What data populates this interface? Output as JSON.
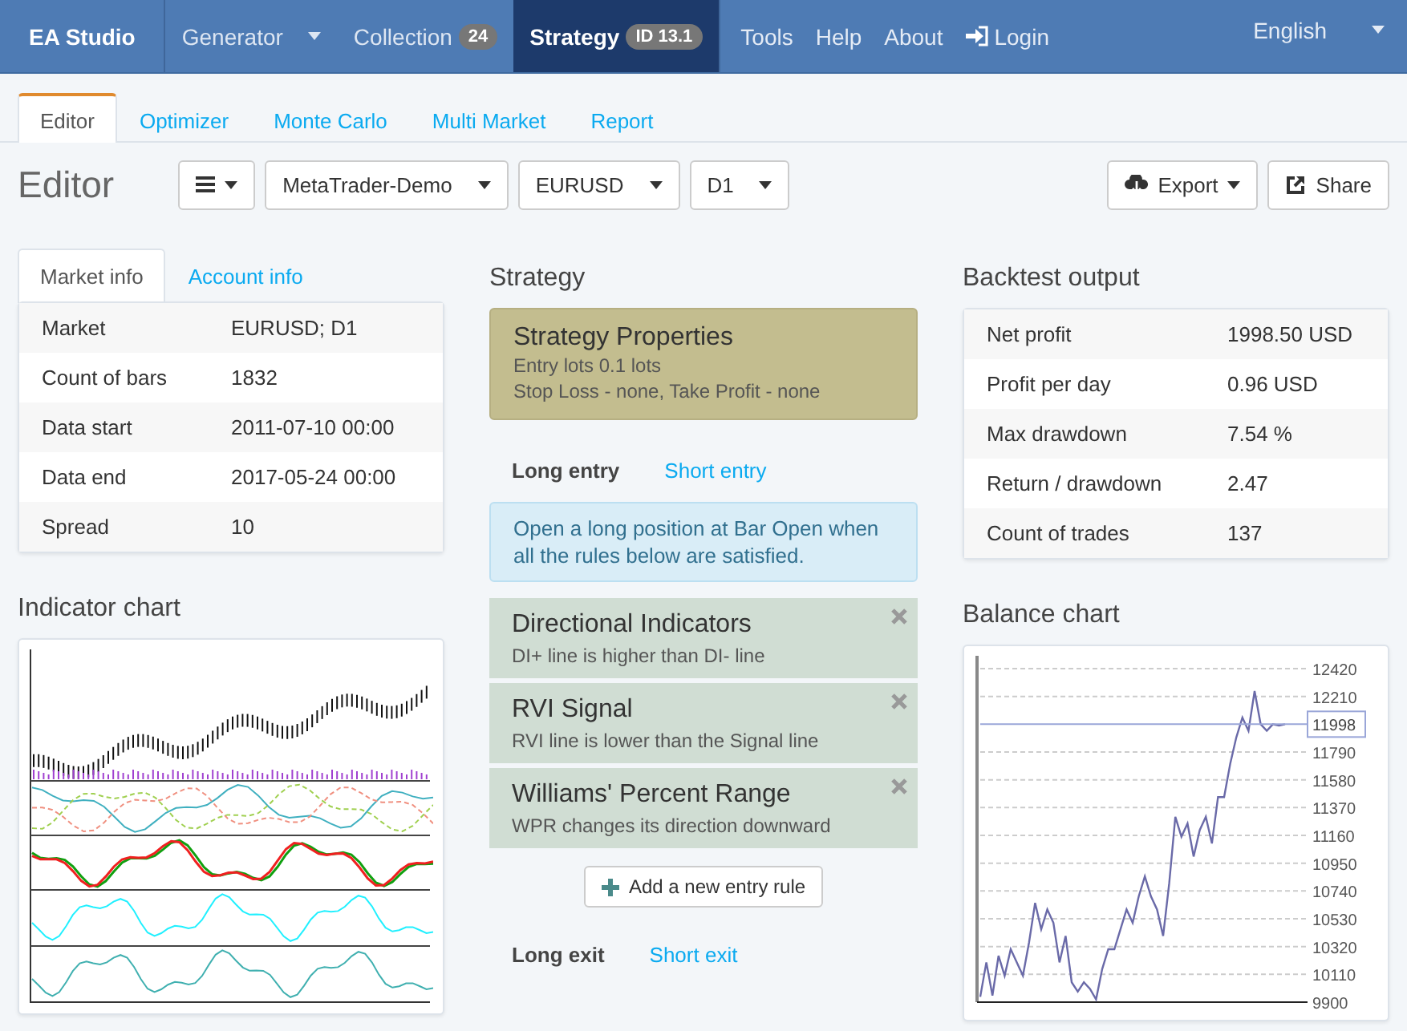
{
  "navbar": {
    "brand": "EA Studio",
    "items": [
      {
        "label": "Generator",
        "caret": true,
        "selected": false
      },
      {
        "label": "Collection",
        "badge": "24",
        "selected": false
      },
      {
        "label": "Strategy",
        "badge": "ID 13.1",
        "selected": true
      }
    ],
    "links": [
      {
        "label": "Tools"
      },
      {
        "label": "Help"
      },
      {
        "label": "About"
      },
      {
        "label": "Login"
      }
    ],
    "language": "English"
  },
  "tabs": [
    {
      "label": "Editor",
      "selected": true
    },
    {
      "label": "Optimizer",
      "selected": false
    },
    {
      "label": "Monte Carlo",
      "selected": false
    },
    {
      "label": "Multi Market",
      "selected": false
    },
    {
      "label": "Report",
      "selected": false
    }
  ],
  "toolbar": {
    "title": "Editor",
    "selects": [
      "MetaTrader-Demo",
      "EURUSD",
      "D1"
    ],
    "export": "Export",
    "share": "Share"
  },
  "info": {
    "tabs": [
      {
        "label": "Market info",
        "selected": true
      },
      {
        "label": "Account info",
        "selected": false
      }
    ],
    "rows": [
      [
        "Market",
        "EURUSD; D1"
      ],
      [
        "Count of bars",
        "1832"
      ],
      [
        "Data start",
        "2011-07-10 00:00"
      ],
      [
        "Data end",
        "2017-05-24 00:00"
      ],
      [
        "Spread",
        "10"
      ]
    ]
  },
  "indicator_chart": {
    "title": "Indicator chart"
  },
  "strategy": {
    "title": "Strategy",
    "properties": {
      "title": "Strategy Properties",
      "lines": [
        "Entry lots 0.1 lots",
        "Stop Loss - none, Take Profit - none"
      ]
    },
    "entry_tabs": [
      {
        "label": "Long entry",
        "selected": true
      },
      {
        "label": "Short entry",
        "selected": false
      }
    ],
    "note": "Open a long position at Bar Open when all the rules below are satisfied.",
    "rules": [
      {
        "title": "Directional Indicators",
        "text": "DI+ line is higher than DI- line"
      },
      {
        "title": "RVI Signal",
        "text": "RVI line is lower than the Signal line"
      },
      {
        "title": "Williams' Percent Range",
        "text": "WPR changes its direction downward"
      }
    ],
    "add_rule": "Add a new entry rule",
    "exit_tabs": [
      {
        "label": "Long exit",
        "selected": true
      },
      {
        "label": "Short exit",
        "selected": false
      }
    ]
  },
  "backtest": {
    "title": "Backtest output",
    "rows": [
      [
        "Net profit",
        "1998.50 USD"
      ],
      [
        "Profit per day",
        "0.96 USD"
      ],
      [
        "Max drawdown",
        "7.54 %"
      ],
      [
        "Return / drawdown",
        "2.47"
      ],
      [
        "Count of trades",
        "137"
      ]
    ]
  },
  "balance_chart": {
    "title": "Balance chart",
    "current": "11998",
    "chart_data": {
      "type": "line",
      "grid": true,
      "ylim": [
        9900,
        12420
      ],
      "yticks": [
        9900,
        10110,
        10320,
        10530,
        10740,
        10950,
        11160,
        11370,
        11580,
        11790,
        12210,
        12420
      ],
      "series": [
        {
          "color": "#6a6aa8",
          "values": [
            9940,
            10200,
            9950,
            10250,
            10100,
            10300,
            10200,
            10100,
            10350,
            10650,
            10450,
            10600,
            10500,
            10200,
            10400,
            10050,
            9980,
            10050,
            10000,
            9920,
            10150,
            10300,
            10300,
            10450,
            10600,
            10500,
            10700,
            10850,
            10700,
            10600,
            10400,
            10800,
            11300,
            11150,
            11250,
            11000,
            11200,
            11300,
            11100,
            11450,
            11450,
            11700,
            11900,
            12050,
            11950,
            12250,
            12000,
            11950,
            12000,
            11990,
            12000
          ]
        }
      ]
    }
  }
}
